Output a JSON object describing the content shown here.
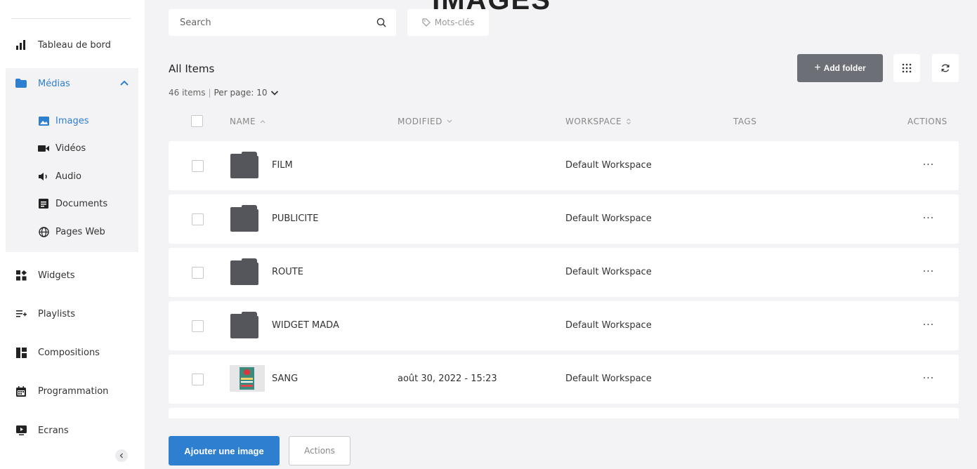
{
  "page": {
    "heading": "IMAGES"
  },
  "colors": {
    "accent": "#2f7fd1",
    "folder": "#55565c",
    "add_folder_bg": "#6c6f76"
  },
  "sidebar": {
    "items_top": [
      {
        "label": "Tableau de bord",
        "icon": "bar-chart-icon"
      }
    ],
    "media": {
      "label": "Médias",
      "icon": "folder-icon",
      "expanded": true,
      "children": [
        {
          "label": "Images",
          "icon": "image-icon",
          "active": true
        },
        {
          "label": "Vidéos",
          "icon": "video-camera-icon"
        },
        {
          "label": "Audio",
          "icon": "speaker-icon"
        },
        {
          "label": "Documents",
          "icon": "document-icon"
        },
        {
          "label": "Pages Web",
          "icon": "globe-icon"
        }
      ]
    },
    "items_bottom": [
      {
        "label": "Widgets",
        "icon": "widgets-icon"
      },
      {
        "label": "Playlists",
        "icon": "playlist-icon"
      },
      {
        "label": "Compositions",
        "icon": "layout-icon"
      },
      {
        "label": "Programmation",
        "icon": "calendar-icon"
      },
      {
        "label": "Ecrans",
        "icon": "screen-play-icon"
      }
    ]
  },
  "search": {
    "placeholder": "Search",
    "value": ""
  },
  "tags_filter": {
    "label": "Mots-clés"
  },
  "list": {
    "title": "All Items",
    "count_text": "46 items",
    "per_page_label": "Per page: 10"
  },
  "toolbar": {
    "add_folder_label": "Add folder"
  },
  "table": {
    "columns": {
      "name": "NAME",
      "modified": "MODIFIED",
      "workspace": "WORKSPACE",
      "tags": "TAGS",
      "actions": "ACTIONS"
    },
    "rows": [
      {
        "type": "folder",
        "name": "FILM",
        "modified": "",
        "workspace": "Default Workspace",
        "tags": ""
      },
      {
        "type": "folder",
        "name": "PUBLICITE",
        "modified": "",
        "workspace": "Default Workspace",
        "tags": ""
      },
      {
        "type": "folder",
        "name": "ROUTE",
        "modified": "",
        "workspace": "Default Workspace",
        "tags": ""
      },
      {
        "type": "folder",
        "name": "WIDGET MADA",
        "modified": "",
        "workspace": "Default Workspace",
        "tags": ""
      },
      {
        "type": "image",
        "name": "SANG",
        "modified": "août 30, 2022 - 15:23",
        "workspace": "Default Workspace",
        "tags": ""
      }
    ],
    "more_label": "···"
  },
  "footer": {
    "primary_label": "Ajouter une image",
    "secondary_label": "Actions"
  }
}
